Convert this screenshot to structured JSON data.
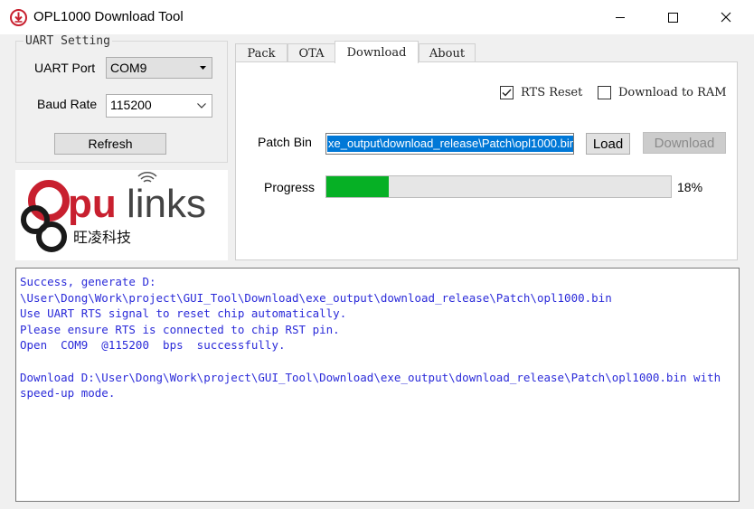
{
  "window": {
    "title": "OPL1000 Download Tool",
    "icons": [
      "download-arrow-icon",
      "minimize-icon",
      "maximize-icon",
      "close-icon"
    ]
  },
  "uart": {
    "group_title": "UART Setting",
    "port_label": "UART Port",
    "port_value": "COM9",
    "baud_label": "Baud Rate",
    "baud_value": "115200",
    "refresh_label": "Refresh"
  },
  "logo": {
    "brand": "Opulinks",
    "chinese": "旺凌科技"
  },
  "tabs": [
    {
      "label": "Pack",
      "active": false
    },
    {
      "label": "OTA",
      "active": false
    },
    {
      "label": "Download",
      "active": true
    },
    {
      "label": "About",
      "active": false
    }
  ],
  "download": {
    "rts_reset_label": "RTS Reset",
    "rts_reset_checked": true,
    "download_ram_label": "Download to RAM",
    "download_ram_checked": false,
    "patch_label": "Patch Bin",
    "patch_value": "xe_output\\download_release\\Patch\\opl1000.bin",
    "load_label": "Load",
    "download_label": "Download",
    "progress_label": "Progress",
    "progress_value": 18,
    "progress_text": "18%"
  },
  "log": {
    "lines": [
      "Success, generate D:",
      "\\User\\Dong\\Work\\project\\GUI_Tool\\Download\\exe_output\\download_release\\Patch\\opl1000.bin",
      "Use UART RTS signal to reset chip automatically.",
      "Please ensure RTS is connected to chip RST pin.",
      "Open  COM9  @115200  bps  successfully.",
      "",
      "Download D:\\User\\Dong\\Work\\project\\GUI_Tool\\Download\\exe_output\\download_release\\Patch\\opl1000.bin with",
      "speed-up mode."
    ]
  },
  "colors": {
    "accent": "#0078d7",
    "progress": "#06b025",
    "log_text": "#2b2bd9",
    "logo_red": "#c8202f"
  }
}
